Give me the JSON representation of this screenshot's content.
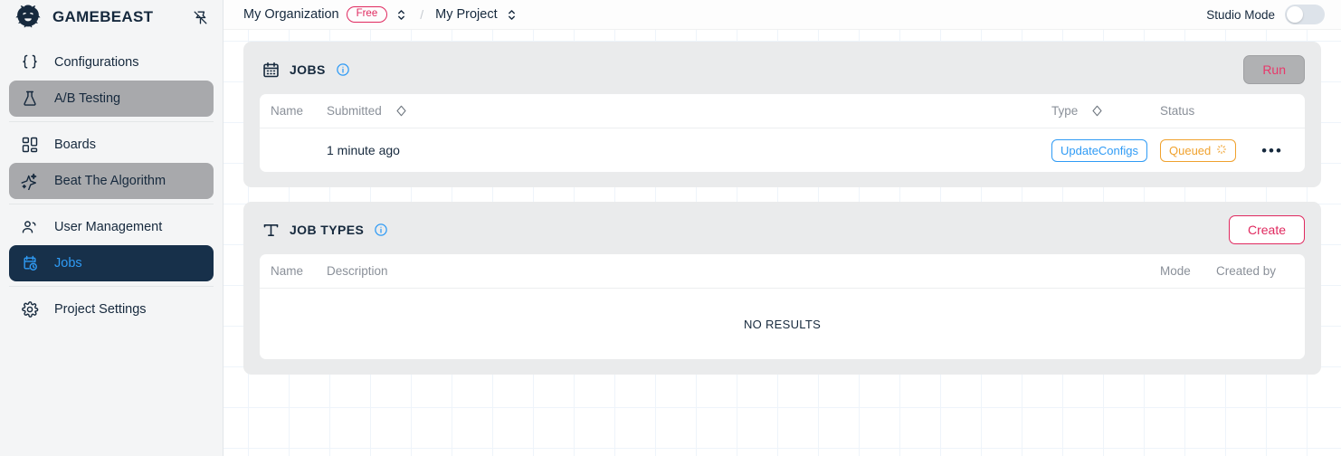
{
  "colors": {
    "accent_pink": "#e0295f",
    "accent_blue": "#2f9bf5",
    "status_orange": "#f0a22e",
    "sidebar_active_bg": "#17304a",
    "sidebar_bg": "#f4f5f6",
    "card_bg": "#eaebec"
  },
  "sidebar": {
    "brand": "GAMEBEAST",
    "pin_icon": "pin-off-icon",
    "groups": [
      {
        "items": [
          {
            "label": "Configurations",
            "icon": "braces-icon",
            "state": "default"
          },
          {
            "label": "A/B Testing",
            "icon": "flask-icon",
            "state": "highlight"
          }
        ]
      },
      {
        "items": [
          {
            "label": "Boards",
            "icon": "grid-icon",
            "state": "default"
          },
          {
            "label": "Beat The Algorithm",
            "icon": "sparkle-icon",
            "state": "highlight"
          }
        ]
      },
      {
        "items": [
          {
            "label": "User Management",
            "icon": "users-icon",
            "state": "default"
          },
          {
            "label": "Jobs",
            "icon": "calendar-clock-icon",
            "state": "active"
          }
        ]
      },
      {
        "items": [
          {
            "label": "Project Settings",
            "icon": "gear-icon",
            "state": "default"
          }
        ]
      }
    ]
  },
  "topbar": {
    "organization": "My Organization",
    "plan_badge": "Free",
    "separator": "/",
    "project": "My Project",
    "studio_mode_label": "Studio Mode",
    "studio_mode_on": false
  },
  "jobs_card": {
    "icon": "calendar-icon",
    "title": "JOBS",
    "info_icon": "info-icon",
    "run_label": "Run",
    "columns": [
      "Name",
      "Submitted",
      "Type",
      "Status"
    ],
    "rows": [
      {
        "name": "",
        "submitted": "1 minute ago",
        "type": "UpdateConfigs",
        "status": "Queued",
        "status_icon": "spinner-icon",
        "menu": "•••"
      }
    ]
  },
  "job_types_card": {
    "icon": "text-t-icon",
    "title": "JOB TYPES",
    "info_icon": "info-icon",
    "create_label": "Create",
    "columns": [
      "Name",
      "Description",
      "Mode",
      "Created by"
    ],
    "empty_text": "NO RESULTS"
  }
}
